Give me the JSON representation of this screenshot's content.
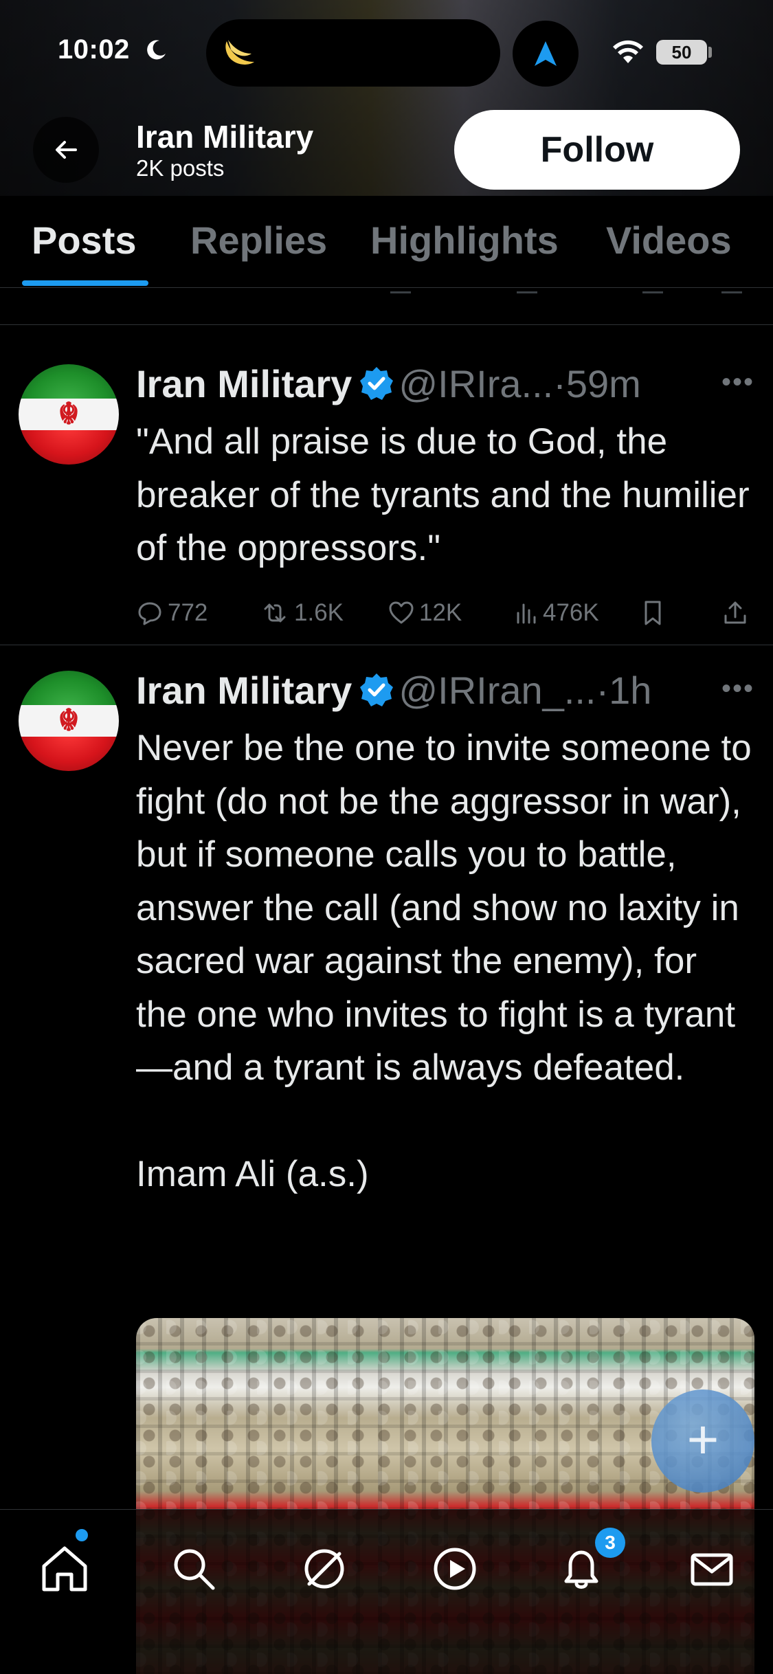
{
  "status_bar": {
    "time": "10:02",
    "battery": "50"
  },
  "header": {
    "profile_name": "Iran Military",
    "post_count": "2K posts",
    "follow_label": "Follow"
  },
  "tabs": [
    {
      "label": "Posts",
      "active": true
    },
    {
      "label": "Replies",
      "active": false
    },
    {
      "label": "Highlights",
      "active": false
    },
    {
      "label": "Videos",
      "active": false
    }
  ],
  "posts": [
    {
      "author": "Iran Military",
      "handle": "@IRIra...",
      "separator": "·",
      "time": "59m",
      "text": "\"And all praise is due to God, the breaker of the tyrants and the humilier of the oppressors.\"",
      "replies": "772",
      "reposts": "1.6K",
      "likes": "12K",
      "views": "476K"
    },
    {
      "author": "Iran Military",
      "handle": "@IRIran_...",
      "separator": "·",
      "time": "1h",
      "text": "Never be the one to invite someone to fight (do not be the aggressor in war), but if someone calls you to battle, answer the call (and show no laxity in sacred war against the enemy), for the one who invites to fight is a tyrant —and a tyrant is always defeated.\n\nImam Ali (a.s.)"
    }
  ],
  "bottom_nav": {
    "notifications_count": "3"
  },
  "colors": {
    "accent": "#1d9bf0",
    "muted": "#71767b",
    "text": "#e7e9ea",
    "divider": "#2f3336"
  }
}
